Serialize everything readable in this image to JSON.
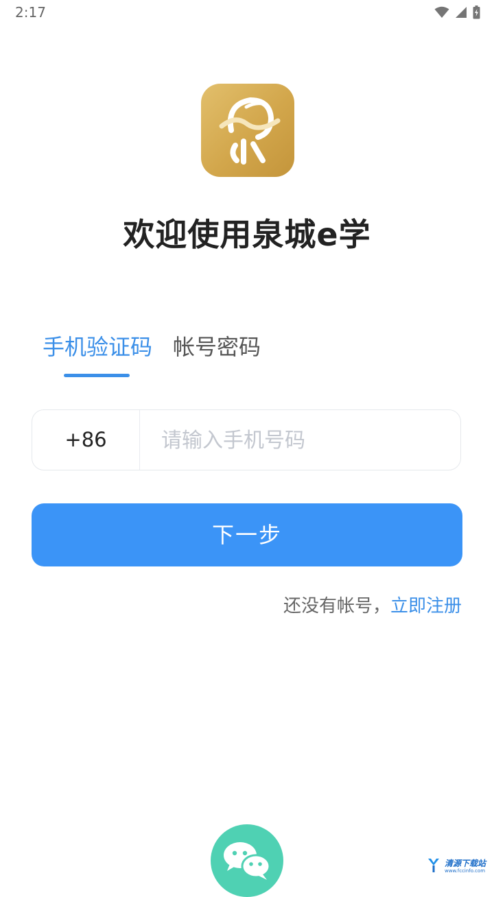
{
  "status_bar": {
    "time": "2:17",
    "icons": [
      "wifi-icon",
      "cellular-signal-icon",
      "battery-charging-icon"
    ]
  },
  "app": {
    "logo_icon": "quancheng-e-xue-logo",
    "welcome_title": "欢迎使用泉城e学",
    "brand_color": "#d4a94f"
  },
  "tabs": [
    {
      "label": "手机验证码",
      "active": true
    },
    {
      "label": "帐号密码",
      "active": false
    }
  ],
  "phone": {
    "country_code": "+86",
    "placeholder": "请输入手机号码",
    "value": ""
  },
  "next_button": {
    "label": "下一步",
    "color": "#3b94f7"
  },
  "register": {
    "prompt": "还没有帐号，",
    "link": "立即注册"
  },
  "wechat_login": {
    "icon": "wechat-icon",
    "color": "#4fd1b3"
  },
  "watermark": {
    "text": "清源下载站",
    "url": "www.fccinfo.com"
  }
}
